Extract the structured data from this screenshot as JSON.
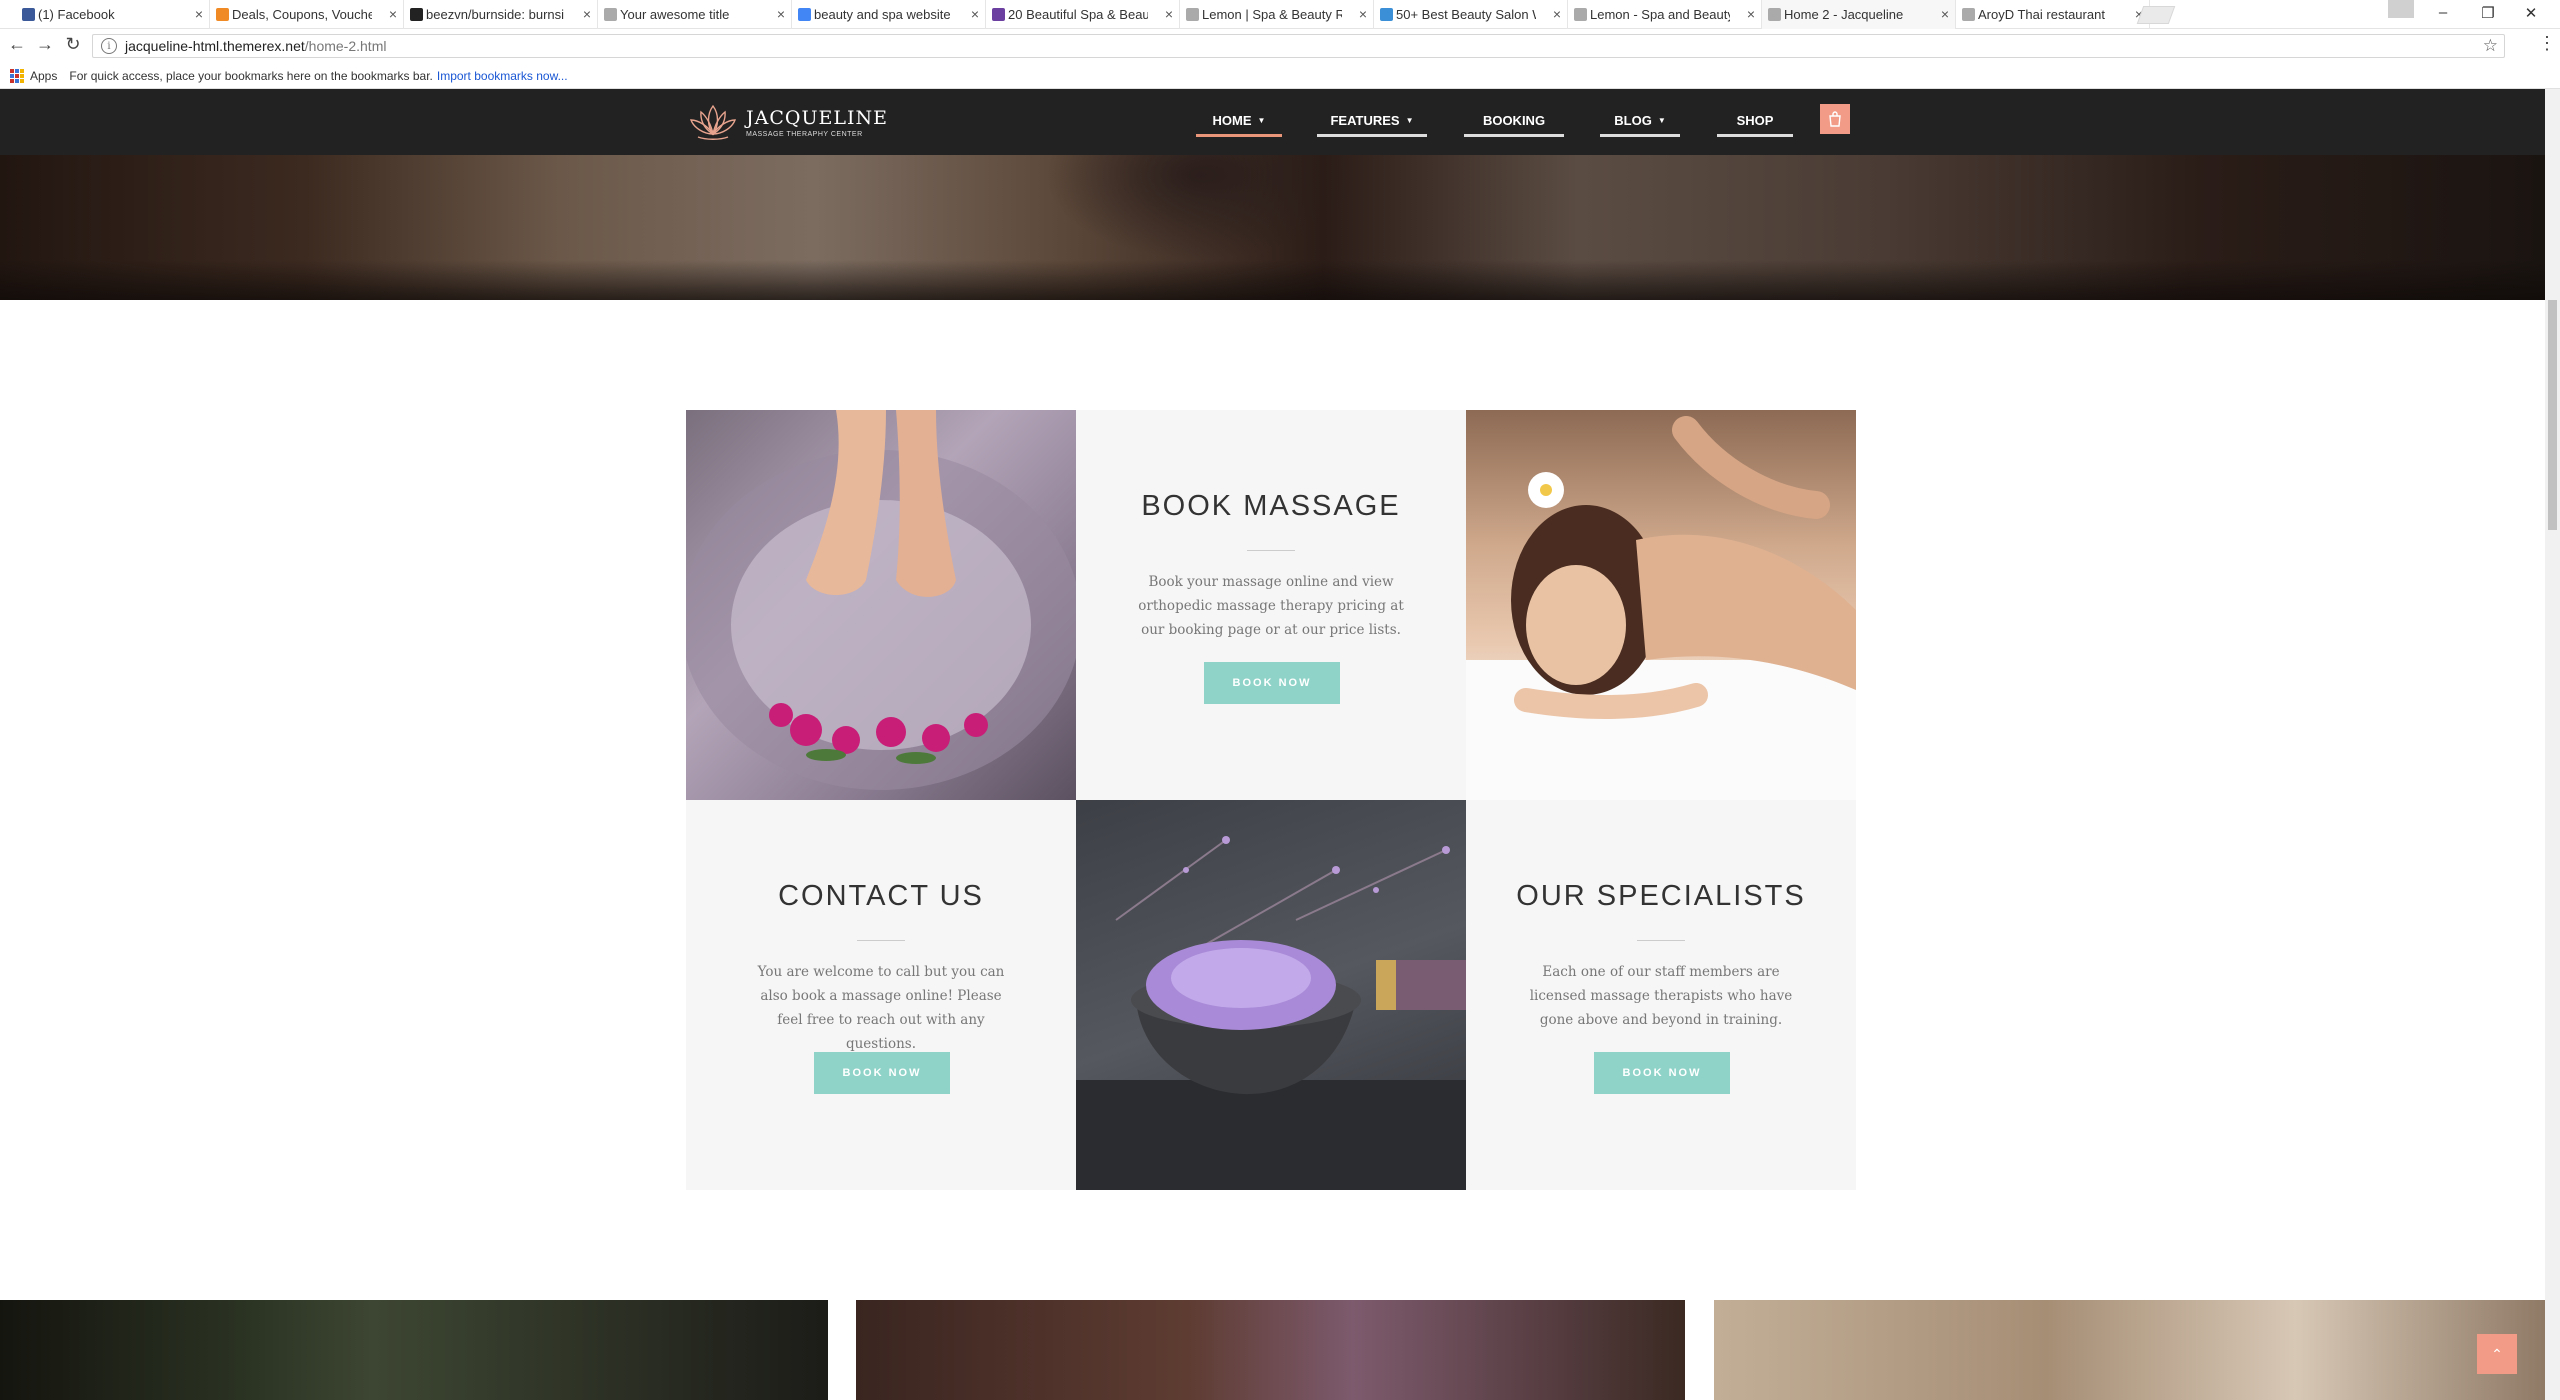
{
  "browser": {
    "tabs": [
      {
        "title": "(1) Facebook",
        "icon": "facebook-icon",
        "color": "#3b5998"
      },
      {
        "title": "Deals, Coupons, Vouche",
        "icon": "deals-icon",
        "color": "#f08a24"
      },
      {
        "title": "beezvn/burnside: burnsi",
        "icon": "github-icon",
        "color": "#222222"
      },
      {
        "title": "Your awesome title",
        "icon": "page-icon",
        "color": "#aaaaaa"
      },
      {
        "title": "beauty and spa website",
        "icon": "google-icon",
        "color": "#4285f4"
      },
      {
        "title": "20 Beautiful Spa & Beau",
        "icon": "site-icon",
        "color": "#6b3fa0"
      },
      {
        "title": "Lemon | Spa & Beauty R",
        "icon": "page-icon",
        "color": "#aaaaaa"
      },
      {
        "title": "50+ Best Beauty Salon W",
        "icon": "site-icon",
        "color": "#3a8fd6"
      },
      {
        "title": "Lemon - Spa and Beauty",
        "icon": "page-icon",
        "color": "#aaaaaa"
      },
      {
        "title": "Home 2 - Jacqueline",
        "icon": "page-icon",
        "color": "#aaaaaa",
        "active": true
      },
      {
        "title": "AroyD Thai restaurant",
        "icon": "page-icon",
        "color": "#aaaaaa"
      }
    ],
    "url_host": "jacqueline-html.themerex.net",
    "url_path": "/home-2.html",
    "bookmarks": {
      "apps_label": "Apps",
      "hint": "For quick access, place your bookmarks here on the bookmarks bar.",
      "import_link": "Import bookmarks now..."
    }
  },
  "site": {
    "logo": {
      "name": "JACQUELINE",
      "tagline": "MASSAGE THERAPHY CENTER"
    },
    "nav": [
      {
        "label": "HOME",
        "dropdown": true,
        "active": true
      },
      {
        "label": "FEATURES",
        "dropdown": true
      },
      {
        "label": "BOOKING",
        "dropdown": false
      },
      {
        "label": "BLOG",
        "dropdown": true
      },
      {
        "label": "SHOP",
        "dropdown": false
      }
    ],
    "accent_color": "#f29b86",
    "button_color": "#8fd3c8"
  },
  "cards": {
    "book": {
      "title": "BOOK MASSAGE",
      "text": "Book your massage online and view orthopedic massage therapy pricing at our booking page or at our price lists.",
      "button": "BOOK NOW"
    },
    "contact": {
      "title": "CONTACT US",
      "text": "You are welcome to call but you can also book a massage online! Please feel free to reach out with any questions.",
      "button": "BOOK NOW"
    },
    "specialists": {
      "title": "OUR SPECIALISTS",
      "text": "Each one of our staff members are licensed massage therapists who have gone above and beyond in training.",
      "button": "BOOK NOW"
    }
  }
}
